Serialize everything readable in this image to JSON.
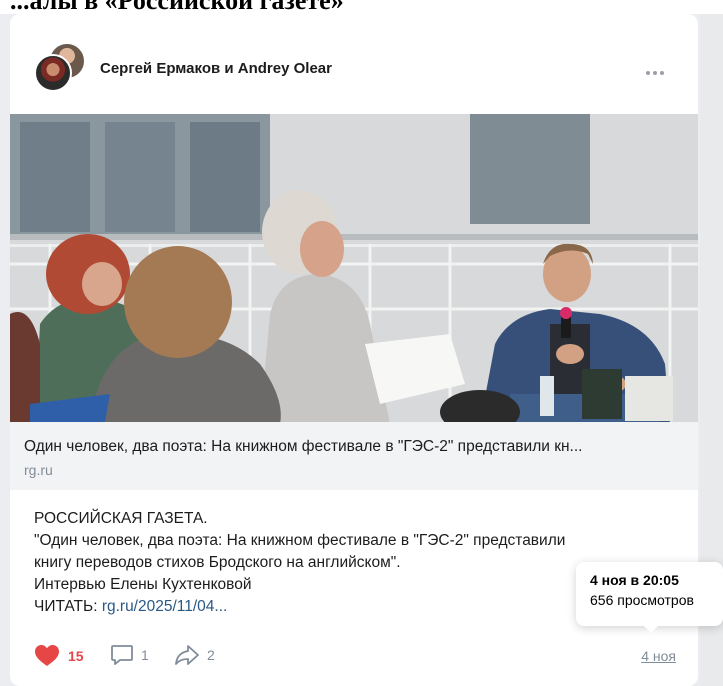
{
  "top_heading": "...алы в «Российской газете»",
  "post": {
    "authors": "Сергей Ермаков и Andrey Olear",
    "more_icon": "more-horizontal-icon",
    "link": {
      "title": "Один человек, два поэта: На книжном фестивале в \"ГЭС-2\" представили кн...",
      "domain": "rg.ru"
    },
    "text_lines": [
      "РОССИЙСКАЯ ГАЗЕТА.",
      "\"Один человек, два поэта: На книжном фестивале в \"ГЭС-2\" представили",
      "книгу переводов стихов Бродского на английском\".",
      "Интервью Елены Кухтенковой"
    ],
    "read_label": "ЧИТАТЬ: ",
    "read_link": "rg.ru/2025/11/04...",
    "likes": "15",
    "comments": "1",
    "shares": "2",
    "date": "4 ноя"
  },
  "tooltip": {
    "datetime": "4 ноя в 20:05",
    "views": "656 просмотров"
  },
  "colors": {
    "like_red": "#e64646",
    "link_blue": "#2a5885",
    "secondary_gray": "#818c99"
  }
}
